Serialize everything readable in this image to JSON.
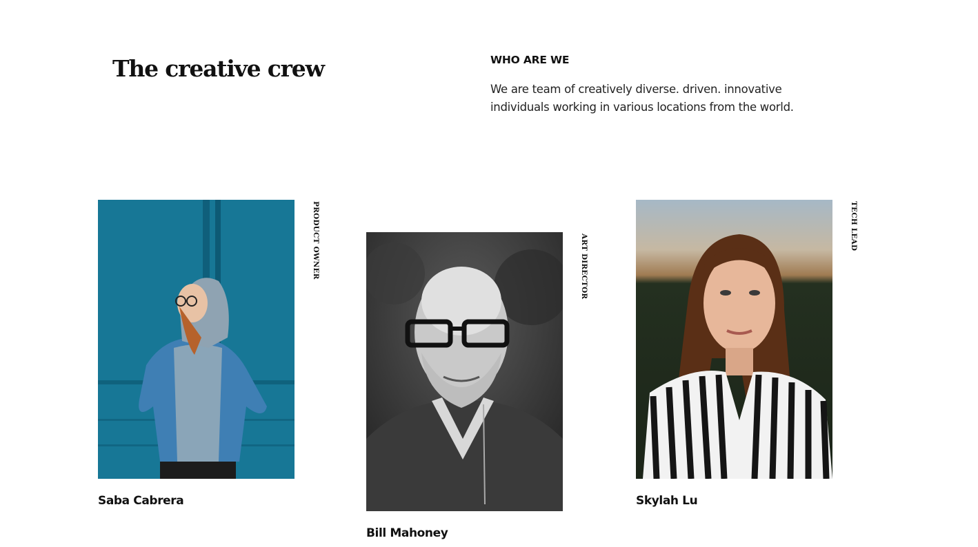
{
  "header": {
    "title": "The creative crew",
    "eyebrow": "WHO ARE WE",
    "intro": "We are team of creatively diverse. driven. innovative individuals working in various locations from the world."
  },
  "team": [
    {
      "name": "Saba Cabrera",
      "role": "PRODUCT OWNER"
    },
    {
      "name": "Bill Mahoney",
      "role": "ART DIRECTOR"
    },
    {
      "name": "Skylah Lu",
      "role": "TECH LEAD"
    }
  ]
}
